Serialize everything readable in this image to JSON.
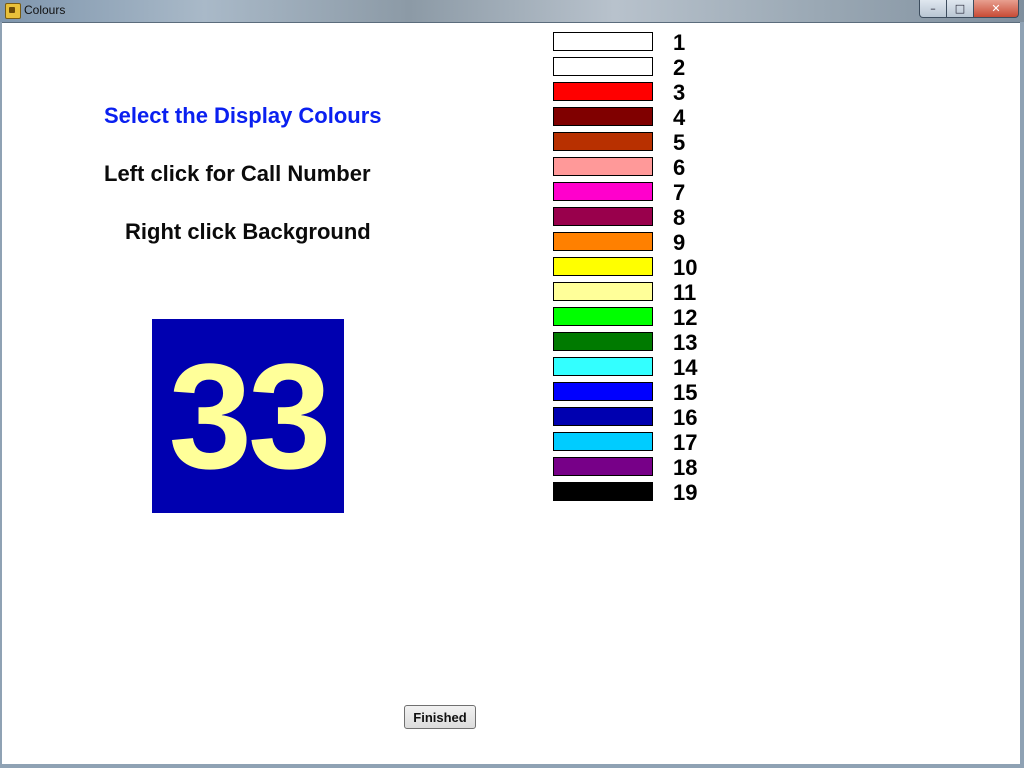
{
  "window": {
    "title": "Colours",
    "controls": {
      "minimize": "–",
      "maximize": "□",
      "close": "✕"
    }
  },
  "main": {
    "heading_select": "Select the Display Colours",
    "heading_left": "Left click for Call Number",
    "heading_right": "Right click Background",
    "preview": {
      "number": "33",
      "number_color": "#FFFF99",
      "background_color": "#0000B0"
    }
  },
  "swatches": [
    {
      "label": "1",
      "color": "#FFFFFF"
    },
    {
      "label": "2",
      "color": "#FFFFFF"
    },
    {
      "label": "3",
      "color": "#FF0000"
    },
    {
      "label": "4",
      "color": "#800000"
    },
    {
      "label": "5",
      "color": "#B83000"
    },
    {
      "label": "6",
      "color": "#FF9999"
    },
    {
      "label": "7",
      "color": "#FF00CC"
    },
    {
      "label": "8",
      "color": "#99004C"
    },
    {
      "label": "9",
      "color": "#FF8000"
    },
    {
      "label": "10",
      "color": "#FFFF00"
    },
    {
      "label": "11",
      "color": "#FFFF99"
    },
    {
      "label": "12",
      "color": "#00FF00"
    },
    {
      "label": "13",
      "color": "#007A00"
    },
    {
      "label": "14",
      "color": "#33FFFF"
    },
    {
      "label": "15",
      "color": "#0000FF"
    },
    {
      "label": "16",
      "color": "#0000B0"
    },
    {
      "label": "17",
      "color": "#00CCFF"
    },
    {
      "label": "18",
      "color": "#770088"
    },
    {
      "label": "19",
      "color": "#000000"
    }
  ],
  "footer": {
    "finished_label": "Finished"
  }
}
